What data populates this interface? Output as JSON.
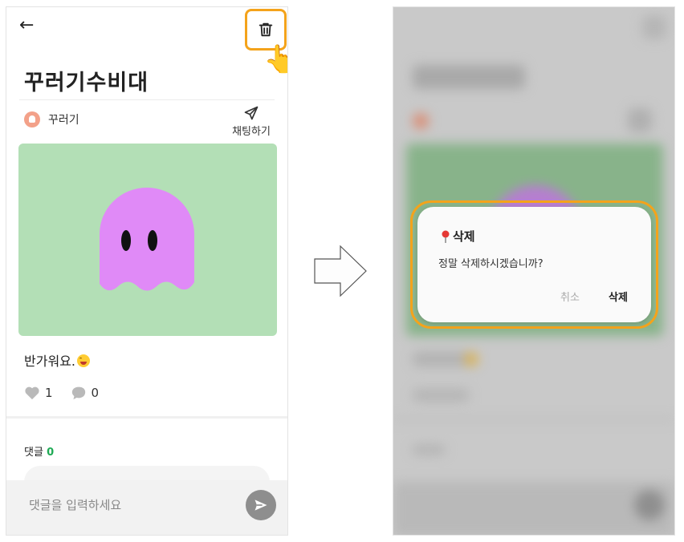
{
  "left": {
    "post_title": "꾸러기수비대",
    "author_name": "꾸러기",
    "chat_label": "채팅하기",
    "caption": "반가워요.",
    "like_count": "1",
    "comment_count": "0",
    "comments_label": "댓글",
    "comments_total": "0",
    "input_placeholder": "댓글을 입력하세요"
  },
  "dialog": {
    "title": "삭제",
    "message": "정말 삭제하시겠습니까?",
    "cancel_label": "취소",
    "confirm_label": "삭제"
  },
  "colors": {
    "highlight": "#f4a31b",
    "image_bg": "#b3dfb6",
    "ghost": "#e08af7",
    "comment_count": "#1faa55"
  },
  "icons": [
    "back-arrow-icon",
    "trash-icon",
    "pointing-hand-icon",
    "send-plane-icon",
    "heart-icon",
    "comment-bubble-icon",
    "send-arrow-icon",
    "pin-icon",
    "right-arrow-icon"
  ]
}
